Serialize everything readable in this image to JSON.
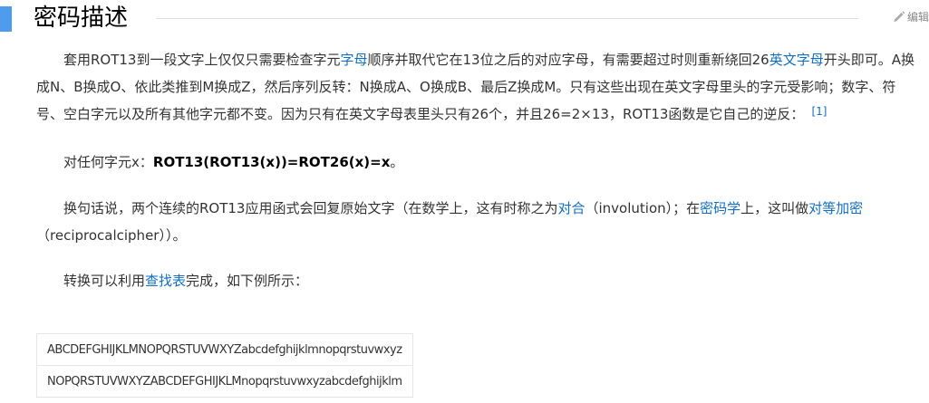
{
  "section": {
    "title": "密码描述",
    "edit_label": "编辑",
    "accent_color": "#4f9cee",
    "link_color": "#136ec2"
  },
  "paragraph1": {
    "seg1": "套用ROT13到一段文字上仅仅只需要检查字元",
    "link1": "字母",
    "seg2": "顺序并取代它在13位之后的对应字母，有需要超过时则重新绕回26",
    "link2": "英文字母",
    "seg3": "开头即可。A换成N、B换成O、依此类推到M换成Z，然后序列反转：N换成A、O换成B、最后Z换成M。只有这些出现在英文字母里头的字元受影响；数字、符号、空白字元以及所有其他字元都不变。因为只有在英文字母表里头只有26个，并且26=2×13，ROT13函数是它自己的逆反：",
    "ref": "[1]"
  },
  "paragraph2": {
    "prefix": "对任何字元x：",
    "formula": "ROT13(ROT13(x))=ROT26(x)=x",
    "suffix": "。"
  },
  "paragraph3": {
    "seg1": "换句话说，两个连续的ROT13应用函式会回复原始文字（在数学上，这有时称之为",
    "link1": "对合",
    "seg2": "（involution）；在",
    "link2": "密码学",
    "seg3": "上，这叫做",
    "link3": "对等加密",
    "seg4": "（reciprocalcipher））。"
  },
  "paragraph4": {
    "seg1": "转换可以利用",
    "link1": "查找表",
    "seg2": "完成，如下例所示："
  },
  "table": {
    "rows": [
      "ABCDEFGHIJKLMNOPQRSTUVWXYZabcdefghijklmnopqrstuvwxyz",
      "NOPQRSTUVWXYZABCDEFGHIJKLMnopqrstuvwxyzabcdefghijklm"
    ]
  },
  "icons": {
    "edit": "pencil-icon"
  }
}
